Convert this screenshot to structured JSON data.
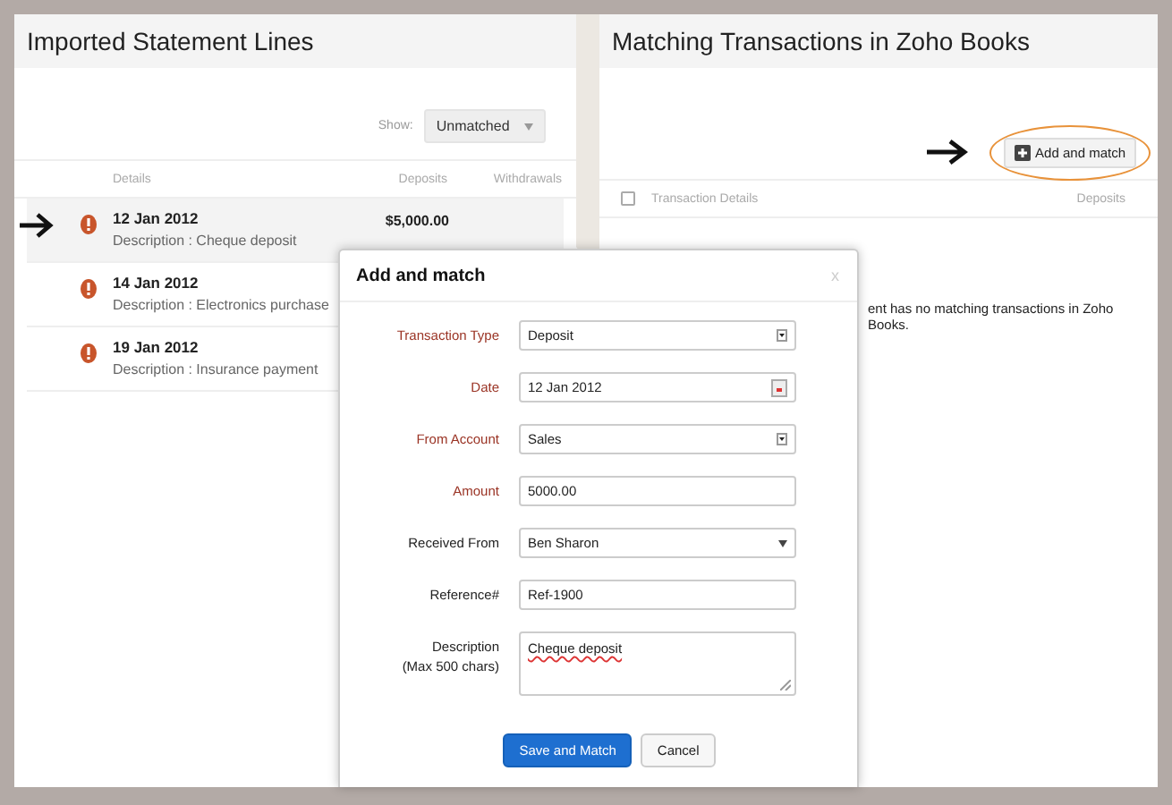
{
  "left_panel": {
    "title": "Imported Statement Lines",
    "show_label": "Show:",
    "show_value": "Unmatched",
    "columns": [
      "Details",
      "Deposits",
      "Withdrawals"
    ],
    "rows": [
      {
        "date": "12 Jan 2012",
        "description": "Description : Cheque deposit",
        "deposit": "$5,000.00",
        "selected": true
      },
      {
        "date": "14 Jan 2012",
        "description": "Description : Electronics purchase",
        "selected": false
      },
      {
        "date": "19 Jan 2012",
        "description": "Description : Insurance payment",
        "selected": false
      }
    ]
  },
  "right_panel": {
    "title": "Matching Transactions in Zoho Books",
    "add_button": "Add and match",
    "select_all_checked": false,
    "columns": [
      "Transaction Details",
      "Deposits"
    ],
    "message": "ent has no matching transactions in Zoho Books."
  },
  "dialog": {
    "title": "Add and match",
    "close": "x",
    "fields": [
      {
        "label": "Transaction Type",
        "kind": "select",
        "value": "Deposit",
        "required": true
      },
      {
        "label": "Date",
        "kind": "date",
        "value": "12 Jan 2012",
        "required": true
      },
      {
        "label": "From Account",
        "kind": "select",
        "value": "Sales",
        "required": true
      },
      {
        "label": "Amount",
        "kind": "text",
        "value": "5000.00",
        "required": true
      },
      {
        "label": "Received From",
        "kind": "combo",
        "value": "Ben Sharon",
        "required": false
      },
      {
        "label": "Reference#",
        "kind": "text",
        "value": "Ref-1900",
        "required": false
      },
      {
        "label": "Description",
        "sublabel": "(Max 500 chars)",
        "kind": "textarea",
        "value": "Cheque deposit",
        "required": false
      }
    ],
    "buttons": [
      "Save and Match",
      "Cancel"
    ]
  }
}
